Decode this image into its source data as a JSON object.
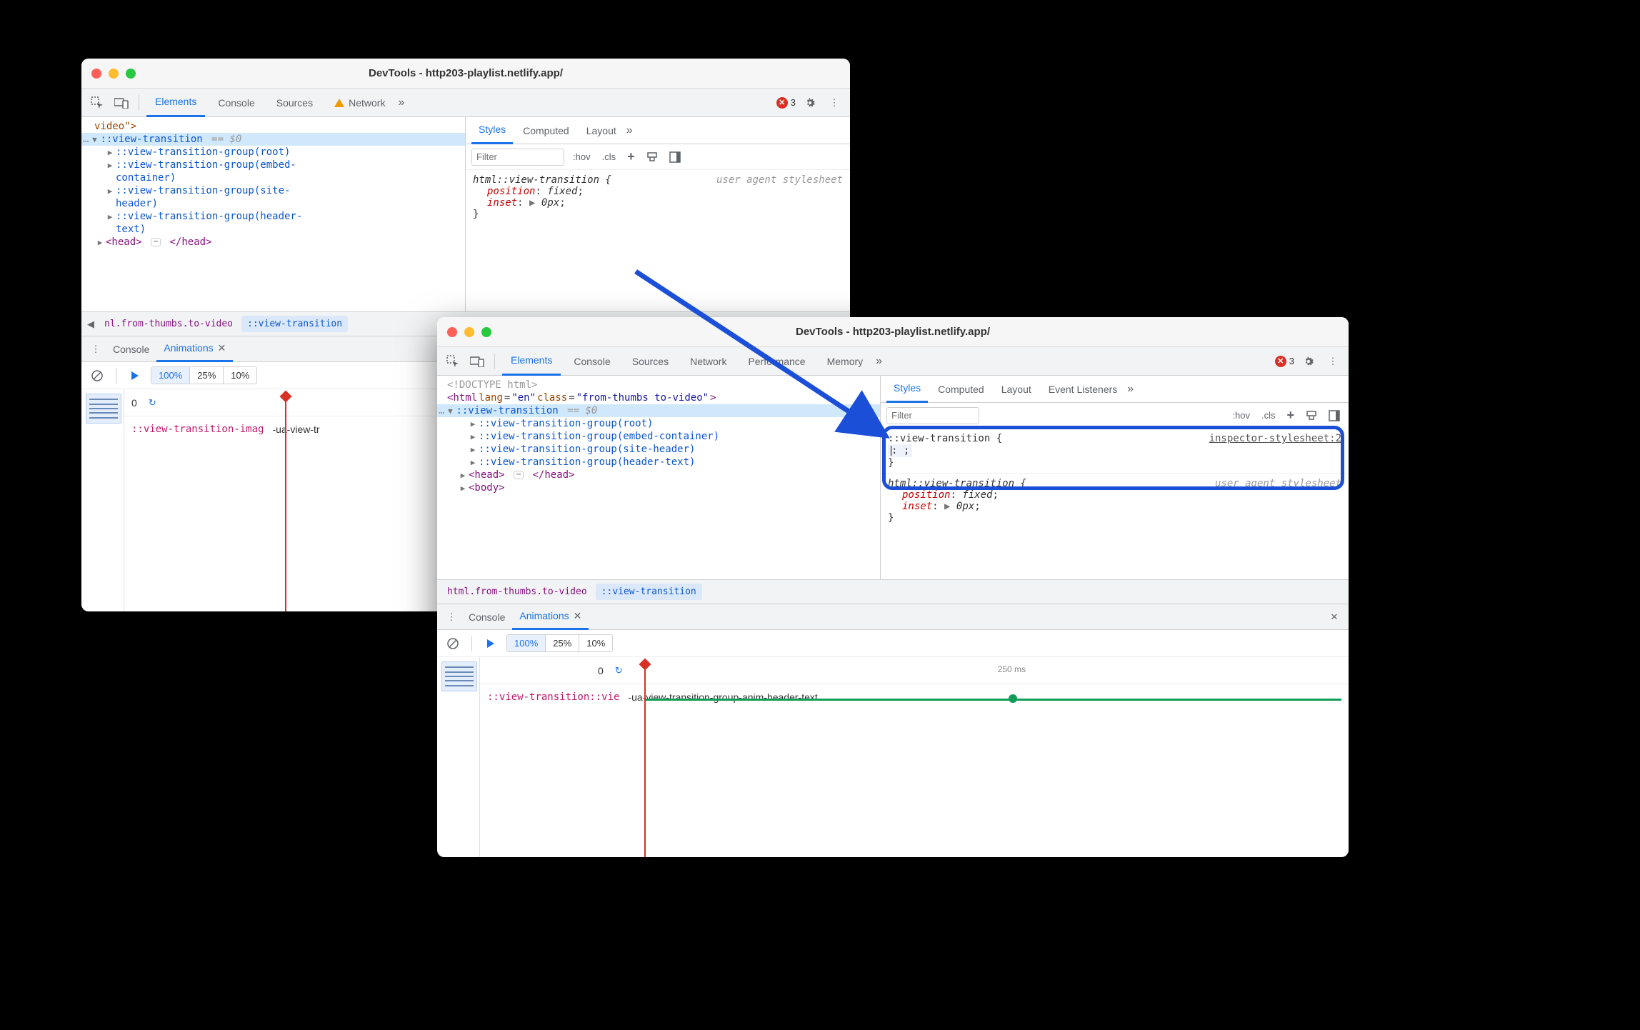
{
  "win1": {
    "title": "DevTools - http203-playlist.netlify.app/",
    "tabs": [
      "Elements",
      "Console",
      "Sources",
      "Network"
    ],
    "tabActive": "Elements",
    "networkHasWarning": true,
    "errorCount": "3",
    "dom": {
      "line0": "video\">",
      "vt": "::view-transition",
      "eqzero": "== $0",
      "g1": "::view-transition-group(root)",
      "g2a": "::view-transition-group(embed-",
      "g2b": "container)",
      "g3a": "::view-transition-group(site-",
      "g3b": "header)",
      "g4a": "::view-transition-group(header-",
      "g4b": "text)",
      "headOpen": "<head>",
      "headClose": "</head>"
    },
    "crumbLeftArrow": "◀",
    "crumb1": "nl.from-thumbs.to-video",
    "crumb2": "::view-transition",
    "styles": {
      "tabs": [
        "Styles",
        "Computed",
        "Layout"
      ],
      "active": "Styles",
      "filterPlaceholder": "Filter",
      "hov": ":hov",
      "cls": ".cls",
      "rule1Selector": "html::view-transition {",
      "rule1Source": "user agent stylesheet",
      "rule1p1": "position",
      "rule1v1": "fixed",
      "rule1p2": "inset",
      "rule1v2": "0px",
      "close": "}"
    },
    "drawer": {
      "menuTabs": [
        "Console",
        "Animations"
      ],
      "active": "Animations",
      "speeds": [
        "100%",
        "25%",
        "10%"
      ],
      "speedActive": "100%",
      "scrub": "0",
      "trackPseudo": "::view-transition-imag",
      "trackAnim": "-ua-view-tr"
    }
  },
  "win2": {
    "title": "DevTools - http203-playlist.netlify.app/",
    "tabs": [
      "Elements",
      "Console",
      "Sources",
      "Network",
      "Performance",
      "Memory"
    ],
    "tabActive": "Elements",
    "errorCount": "3",
    "dom": {
      "doctype": "<!DOCTYPE html>",
      "htmlOpen1": "<html ",
      "langAttr": "lang",
      "langVal": "\"en\"",
      "classAttr": "class",
      "classVal": "\"from-thumbs to-video\"",
      "htmlOpen2": ">",
      "vt": "::view-transition",
      "eqzero": "== $0",
      "g1": "::view-transition-group(root)",
      "g2": "::view-transition-group(embed-container)",
      "g3": "::view-transition-group(site-header)",
      "g4": "::view-transition-group(header-text)",
      "headOpen": "<head>",
      "headClose": "</head>",
      "bodyOpen": "<body>"
    },
    "crumb1": "html.from-thumbs.to-video",
    "crumb2": "::view-transition",
    "styles": {
      "tabs": [
        "Styles",
        "Computed",
        "Layout",
        "Event Listeners"
      ],
      "active": "Styles",
      "filterPlaceholder": "Filter",
      "hov": ":hov",
      "cls": ".cls",
      "ruleNewSel": "::view-transition {",
      "ruleNewSrc": "inspector-stylesheet:2",
      "ruleNewEmpty": ": ;",
      "close": "}",
      "rule2Selector": "html::view-transition {",
      "rule2Source": "user agent stylesheet",
      "rule2p1": "position",
      "rule2v1": "fixed",
      "rule2p2": "inset",
      "rule2v2": "0px"
    },
    "drawer": {
      "menuTabs": [
        "Console",
        "Animations"
      ],
      "active": "Animations",
      "speeds": [
        "100%",
        "25%",
        "10%"
      ],
      "speedActive": "100%",
      "scrub": "0",
      "tickLabel": "250 ms",
      "trackPseudo": "::view-transition::vie",
      "trackAnim": "-ua-view-transition-group-anim-header-text"
    }
  }
}
